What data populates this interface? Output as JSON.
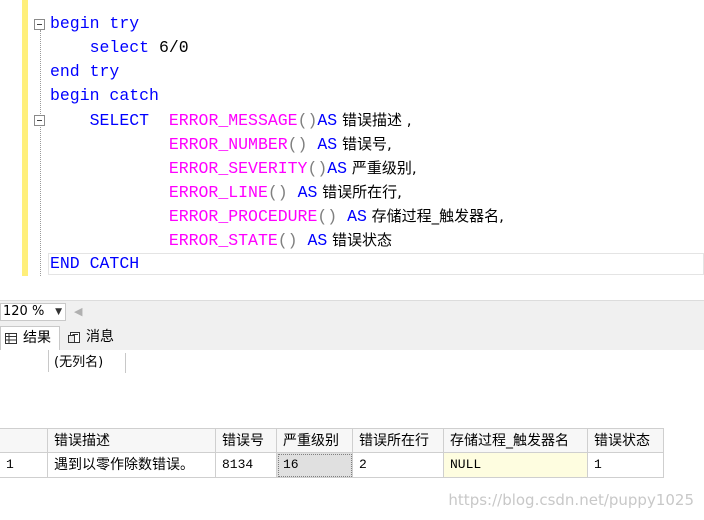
{
  "editor": {
    "line1_kw1": "begin",
    "line1_kw2": "try",
    "line2_kw": "select",
    "line2_expr": "6/0",
    "line3_kw1": "end",
    "line3_kw2": "try",
    "line4_kw1": "begin",
    "line4_kw2": "catch",
    "line5_kw": "SELECT",
    "line5_fn": "ERROR_MESSAGE",
    "line5_parens": "()",
    "line5_as": "AS",
    "line5_alias": " 错误描述 ,",
    "line6_fn": "ERROR_NUMBER",
    "line6_parens": "()",
    "line6_as": "AS",
    "line6_alias": " 错误号,",
    "line7_fn": "ERROR_SEVERITY",
    "line7_parens": "()",
    "line7_as": "AS",
    "line7_alias": " 严重级别,",
    "line8_fn": "ERROR_LINE",
    "line8_parens": "()",
    "line8_as": "AS",
    "line8_alias": " 错误所在行,",
    "line9_fn": "ERROR_PROCEDURE",
    "line9_parens": "()",
    "line9_as": "AS",
    "line9_alias": " 存储过程_触发器名,",
    "line10_fn": "ERROR_STATE",
    "line10_parens": "()",
    "line10_as": "AS",
    "line10_alias": " 错误状态",
    "line11_kw1": "END",
    "line11_kw2": "CATCH"
  },
  "zoom": {
    "value": "120 %",
    "arrow_icon": "chevron-down-icon"
  },
  "tabs": [
    {
      "label": "结果",
      "icon": "grid-icon"
    },
    {
      "label": "消息",
      "icon": "message-icon"
    }
  ],
  "grid1": {
    "header": "(无列名)"
  },
  "grid2": {
    "headers": [
      "错误描述",
      "错误号",
      "严重级别",
      "错误所在行",
      "存储过程_触发器名",
      "错误状态"
    ],
    "row_number": "1",
    "row": [
      "遇到以零作除数错误。",
      "8134",
      "16",
      "2",
      "NULL",
      "1"
    ]
  },
  "watermark": "https://blog.csdn.net/puppy1025",
  "colors": {
    "keyword": "#0000ff",
    "function": "#ff00ff",
    "operator": "#808080",
    "change_bar": "#ffef7a",
    "null_bg": "#fefde0"
  }
}
